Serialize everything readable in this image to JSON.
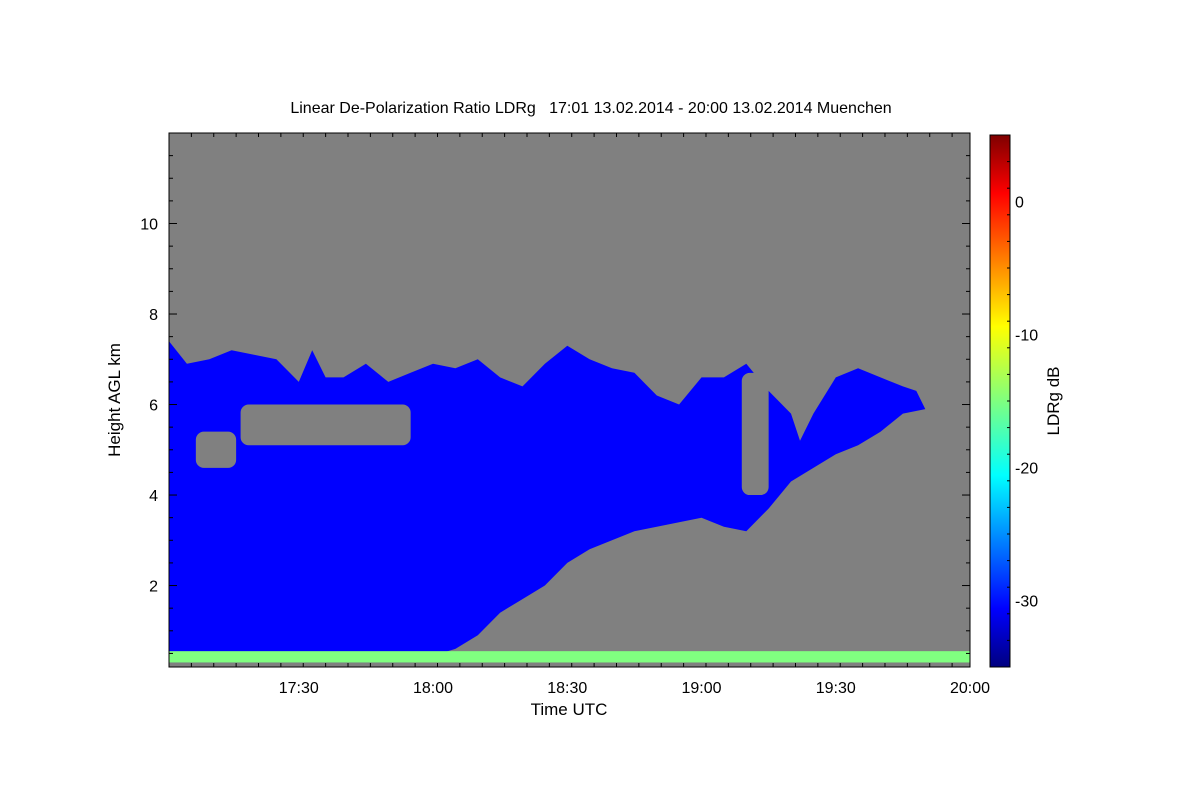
{
  "chart_data": {
    "type": "heatmap",
    "title": "Linear De-Polarization Ratio LDRg   17:01 13.02.2014 - 20:00 13.02.2014 Muenchen",
    "xlabel": "Time UTC",
    "ylabel": "Height AGL km",
    "x_range": [
      "17:01",
      "20:00"
    ],
    "y_range": [
      0.2,
      12
    ],
    "x_ticks": [
      {
        "value": "17:30",
        "label": "17:30"
      },
      {
        "value": "18:00",
        "label": "18:00"
      },
      {
        "value": "18:30",
        "label": "18:30"
      },
      {
        "value": "19:00",
        "label": "19:00"
      },
      {
        "value": "19:30",
        "label": "19:30"
      },
      {
        "value": "20:00",
        "label": "20:00"
      }
    ],
    "y_ticks": [
      {
        "value": 2,
        "label": "2"
      },
      {
        "value": 4,
        "label": "4"
      },
      {
        "value": 6,
        "label": "6"
      },
      {
        "value": 8,
        "label": "8"
      },
      {
        "value": 10,
        "label": "10"
      }
    ],
    "colorbar": {
      "label": "LDRg dB",
      "range": [
        -35,
        5
      ],
      "ticks": [
        {
          "value": 0,
          "label": "0"
        },
        {
          "value": -10,
          "label": "-10"
        },
        {
          "value": -20,
          "label": "-20"
        },
        {
          "value": -30,
          "label": "-30"
        }
      ],
      "colormap": "jet"
    },
    "no_data_color": "#808080",
    "cloud_layer": {
      "ldr_db": -30,
      "top_km": [
        [
          "17:01",
          7.4
        ],
        [
          "17:05",
          6.9
        ],
        [
          "17:10",
          7.0
        ],
        [
          "17:15",
          7.2
        ],
        [
          "17:20",
          7.1
        ],
        [
          "17:25",
          7.0
        ],
        [
          "17:30",
          6.5
        ],
        [
          "17:33",
          7.2
        ],
        [
          "17:36",
          6.6
        ],
        [
          "17:40",
          6.6
        ],
        [
          "17:45",
          6.9
        ],
        [
          "17:50",
          6.5
        ],
        [
          "17:55",
          6.7
        ],
        [
          "18:00",
          6.9
        ],
        [
          "18:05",
          6.8
        ],
        [
          "18:10",
          7.0
        ],
        [
          "18:15",
          6.6
        ],
        [
          "18:20",
          6.4
        ],
        [
          "18:25",
          6.9
        ],
        [
          "18:30",
          7.3
        ],
        [
          "18:35",
          7.0
        ],
        [
          "18:40",
          6.8
        ],
        [
          "18:45",
          6.7
        ],
        [
          "18:50",
          6.2
        ],
        [
          "18:55",
          6.0
        ],
        [
          "19:00",
          6.6
        ],
        [
          "19:05",
          6.6
        ],
        [
          "19:10",
          6.9
        ],
        [
          "19:15",
          6.3
        ],
        [
          "19:20",
          5.8
        ],
        [
          "19:22",
          5.2
        ],
        [
          "19:25",
          5.8
        ],
        [
          "19:30",
          6.6
        ],
        [
          "19:35",
          6.8
        ],
        [
          "19:40",
          6.6
        ],
        [
          "19:45",
          6.4
        ],
        [
          "19:48",
          6.3
        ],
        [
          "19:50",
          5.9
        ]
      ],
      "base_km": [
        [
          "17:01",
          0.3
        ],
        [
          "17:55",
          0.3
        ],
        [
          "18:05",
          0.6
        ],
        [
          "18:10",
          0.9
        ],
        [
          "18:15",
          1.4
        ],
        [
          "18:20",
          1.7
        ],
        [
          "18:25",
          2.0
        ],
        [
          "18:30",
          2.5
        ],
        [
          "18:35",
          2.8
        ],
        [
          "18:40",
          3.0
        ],
        [
          "18:45",
          3.2
        ],
        [
          "18:50",
          3.3
        ],
        [
          "18:55",
          3.4
        ],
        [
          "19:00",
          3.5
        ],
        [
          "19:05",
          3.3
        ],
        [
          "19:10",
          3.2
        ],
        [
          "19:15",
          3.7
        ],
        [
          "19:20",
          4.3
        ],
        [
          "19:25",
          4.6
        ],
        [
          "19:30",
          4.9
        ],
        [
          "19:35",
          5.1
        ],
        [
          "19:40",
          5.4
        ],
        [
          "19:45",
          5.8
        ],
        [
          "19:50",
          5.9
        ]
      ],
      "gaps": [
        {
          "from": "17:07",
          "to": "17:16",
          "bottom_km": 4.6,
          "top_km": 5.4
        },
        {
          "from": "17:17",
          "to": "17:55",
          "bottom_km": 5.1,
          "top_km": 6.0
        },
        {
          "from": "19:09",
          "to": "19:15",
          "bottom_km": 4.0,
          "top_km": 6.7
        }
      ]
    },
    "boundary_layer": {
      "ldr_db": -15,
      "from": "17:01",
      "to": "20:00",
      "bottom_km": 0.3,
      "top_km": 0.55
    }
  }
}
